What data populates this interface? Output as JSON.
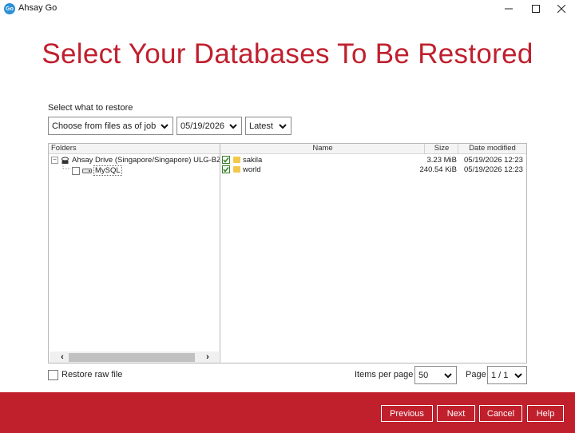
{
  "window": {
    "app_logo_text": "Go",
    "title": "Ahsay Go"
  },
  "page": {
    "title": "Select Your Databases To Be Restored"
  },
  "restore_options": {
    "label": "Select what to restore",
    "mode_value": "Choose from files as of job",
    "date_value": "05/19/2026",
    "version_value": "Latest"
  },
  "tree": {
    "header": "Folders",
    "root_label": "Ahsay Drive (Singapore/Singapore) ULG-BZZ",
    "child_label": "MySQL"
  },
  "file_list": {
    "columns": {
      "name": "Name",
      "size": "Size",
      "modified": "Date modified"
    },
    "rows": [
      {
        "name": "sakila",
        "size": "3.23 MiB",
        "modified": "05/19/2026 12:23",
        "checked": true
      },
      {
        "name": "world",
        "size": "240.54 KiB",
        "modified": "05/19/2026 12:23",
        "checked": true
      }
    ]
  },
  "options": {
    "restore_raw_label": "Restore raw file"
  },
  "pagination": {
    "items_per_page_label": "Items per page",
    "items_per_page_value": "50",
    "page_label": "Page",
    "page_value": "1 / 1"
  },
  "footer": {
    "previous": "Previous",
    "next": "Next",
    "cancel": "Cancel",
    "help": "Help"
  },
  "colors": {
    "accent": "#c01f2c",
    "check": "#3a7d2c",
    "folder": "#f2c94c"
  }
}
